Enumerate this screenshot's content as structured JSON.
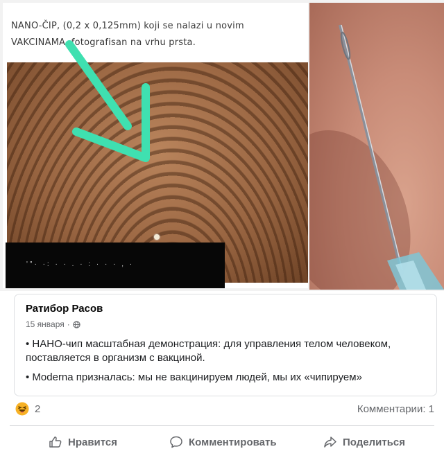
{
  "image": {
    "caption_line1": "NANO-ČIP, (0,2 x 0,125mm) koji se nalazi u novim",
    "caption_line2": "VAKCINAMA, fotografisan na vrhu prsta.",
    "redacted_text": "'\"·  ·:  ·  · . ·  :  ·  ·  ·  ,  ·",
    "arrow_color": "#3fe0b0"
  },
  "post": {
    "author": "Ратибор Расов",
    "date": "15 января",
    "separator": "·",
    "privacy_icon": "globe-icon",
    "bullet1": "• НАНО-чип масштабная демонстрация: для управления телом человеком, поставляется в организм с вакциной.",
    "bullet2": "• Moderna призналась: мы не вакцинируем людей, мы их «чипируем»"
  },
  "stats": {
    "reaction_icon": "haha-icon",
    "reaction_count": "2",
    "comments": "Комментарии: 1"
  },
  "actions": {
    "like": "Нравится",
    "comment": "Комментировать",
    "share": "Поделиться"
  },
  "colors": {
    "muted": "#65676b",
    "text": "#1c1e21",
    "border": "#dddfe2",
    "haha": "#f7b125"
  }
}
